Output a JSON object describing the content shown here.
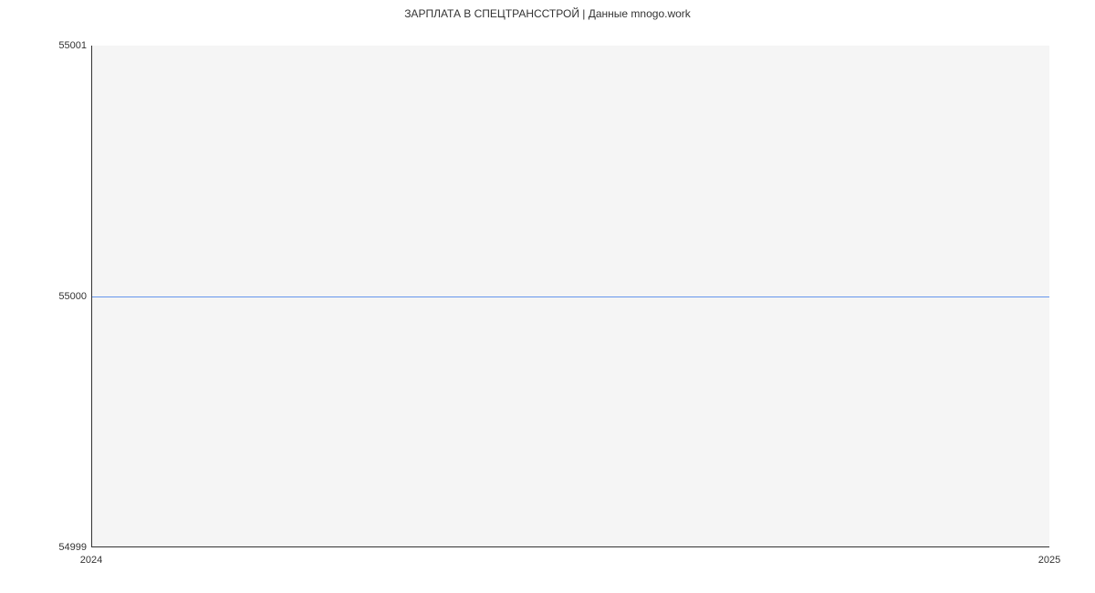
{
  "chart_data": {
    "type": "line",
    "title": "ЗАРПЛАТА В СПЕЦТРАНССТРОЙ | Данные mnogo.work",
    "x": [
      2024,
      2025
    ],
    "values": [
      55000,
      55000
    ],
    "xlim": [
      2024,
      2025
    ],
    "ylim": [
      54999,
      55001
    ],
    "x_ticks": [
      2024,
      2025
    ],
    "y_ticks": [
      54999,
      55000,
      55001
    ],
    "xlabel": "",
    "ylabel": ""
  }
}
